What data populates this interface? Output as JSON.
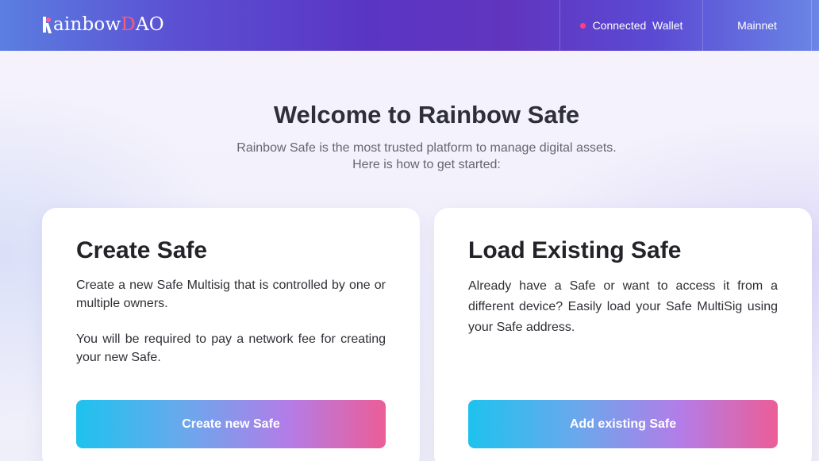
{
  "header": {
    "logo_r": "R",
    "logo_ainbow": "ainbow ",
    "logo_d": "D",
    "logo_ao": "AO",
    "wallet_label": "Connected  Wallet",
    "network_label": "Mainnet"
  },
  "hero": {
    "title": "Welcome to Rainbow Safe",
    "subtitle_line1": "Rainbow Safe is the most trusted platform to manage digital assets.",
    "subtitle_line2": "Here is how to get started:"
  },
  "cards": {
    "create": {
      "title": "Create Safe",
      "desc1": "Create a new Safe Multisig that is controlled by one or multiple owners.",
      "desc2": "You will be required to pay a network fee for creating your new Safe.",
      "button": "Create new Safe"
    },
    "load": {
      "title": "Load Existing Safe",
      "desc": "Already have a Safe or want to access it from a different device? Easily load your Safe MultiSig using your Safe address.",
      "button": "Add existing Safe"
    }
  },
  "colors": {
    "status_dot": "#ff3f7f",
    "logo_accent": "#ff5a7a"
  }
}
